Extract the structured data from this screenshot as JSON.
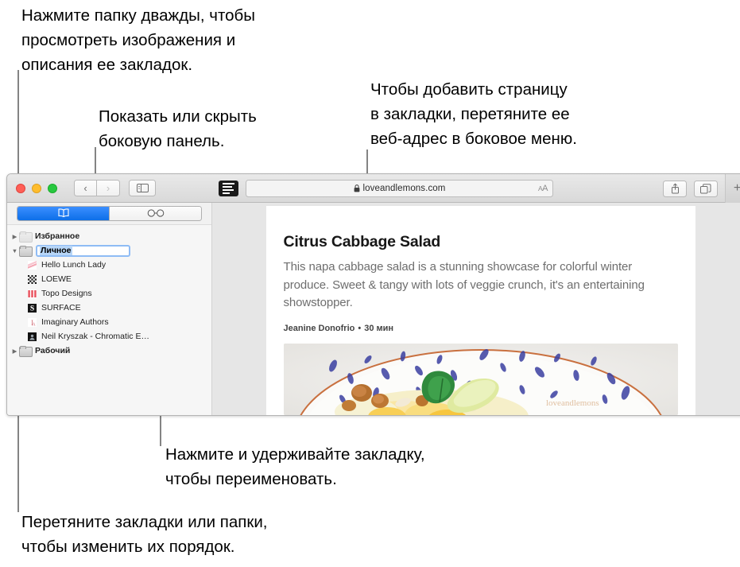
{
  "callouts": [
    {
      "id": "double-click-folder",
      "text": "Нажмите папку дважды, чтобы\nпросмотреть изображения и\nописания ее закладок."
    },
    {
      "id": "show-hide-sidebar",
      "text": "Показать или скрыть\nбоковую панель."
    },
    {
      "id": "drag-url-to-sidebar",
      "text": "Чтобы добавить страницу\nв закладки, перетяните ее\nвеб-адрес в боковое меню."
    },
    {
      "id": "press-hold-rename",
      "text": "Нажмите и удерживайте закладку,\nчтобы переименовать."
    },
    {
      "id": "drag-to-reorder",
      "text": "Перетяните закладки или папки,\nчтобы изменить их порядок."
    }
  ],
  "window": {
    "toolbar": {
      "traffic_lights": [
        "close",
        "minimize",
        "zoom"
      ],
      "back_label": "‹",
      "forward_label": "›",
      "sidebar_toggle_name": "sidebar-toggle-icon",
      "reader_button_name": "reader-view-icon",
      "url": "loveandlemons.com",
      "lock_glyph": "🔒",
      "reader_size_small": "A",
      "reader_size_large": "A",
      "share_glyph": "↑",
      "tabs_overview_name": "tab-overview-icon",
      "new_tab_label": "+"
    },
    "sidebar": {
      "segments": [
        {
          "id": "bookmarks",
          "icon": "📖",
          "selected": true
        },
        {
          "id": "reading-list",
          "icon": "○○",
          "selected": false
        }
      ],
      "items": [
        {
          "label": "Избранное",
          "type": "folder",
          "expanded": false,
          "level": 0
        },
        {
          "label": "Личное",
          "type": "folder",
          "expanded": true,
          "level": 0,
          "editing": true
        },
        {
          "label": "Hello Lunch Lady",
          "type": "bookmark",
          "level": 1,
          "favicon": "hello-lunch-lady"
        },
        {
          "label": "LOEWE",
          "type": "bookmark",
          "level": 1,
          "favicon": "loewe"
        },
        {
          "label": "Topo Designs",
          "type": "bookmark",
          "level": 1,
          "favicon": "topo-designs"
        },
        {
          "label": "SURFACE",
          "type": "bookmark",
          "level": 1,
          "favicon": "surface"
        },
        {
          "label": "Imaginary Authors",
          "type": "bookmark",
          "level": 1,
          "favicon": "imaginary-authors"
        },
        {
          "label": "Neil Kryszak - Chromatic E…",
          "type": "bookmark",
          "level": 1,
          "favicon": "neil-kryszak"
        },
        {
          "label": "Рабочий",
          "type": "folder",
          "expanded": false,
          "level": 0
        }
      ]
    },
    "page": {
      "title": "Citrus Cabbage Salad",
      "summary": "This napa cabbage salad is a stunning showcase for colorful winter produce. Sweet & tangy with lots of veggie crunch, it's an entertaining showstopper.",
      "author": "Jeanine Donofrio",
      "separator": "•",
      "read_time": "30 мин",
      "photo_alt": "citrus-cabbage-salad-photo"
    }
  },
  "colors": {
    "accent_blue": "#0d6fe8",
    "selection_blue": "#b6d5f7",
    "edit_border": "#8fbcf5",
    "callout_line": "#848484",
    "window_chrome": "#ececec"
  }
}
